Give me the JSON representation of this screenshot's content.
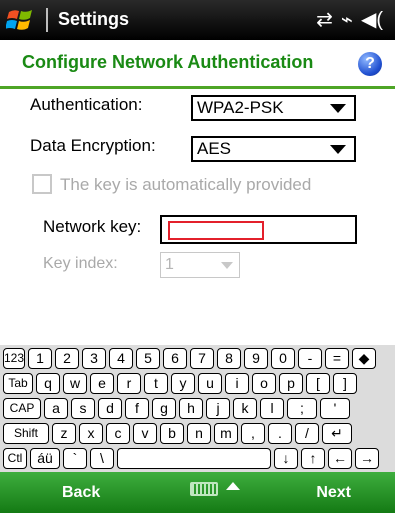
{
  "titlebar": {
    "title": "Settings",
    "icons": [
      "connectivity-icon",
      "battery-charging-icon",
      "volume-icon"
    ]
  },
  "header": {
    "title": "Configure Network Authentication",
    "help_icon": "help-icon",
    "help_glyph": "?"
  },
  "form": {
    "authentication_label": "Authentication:",
    "authentication_value": "WPA2-PSK",
    "encryption_label": "Data Encryption:",
    "encryption_value": "AES",
    "auto_key_label": "The key is automatically provided",
    "auto_key_checked": false,
    "network_key_label": "Network key:",
    "network_key_value": "",
    "key_index_label": "Key index:",
    "key_index_value": "1"
  },
  "keyboard": {
    "rows": [
      [
        "123",
        "1",
        "2",
        "3",
        "4",
        "5",
        "6",
        "7",
        "8",
        "9",
        "0",
        "-",
        "=",
        "◆"
      ],
      [
        "Tab",
        "q",
        "w",
        "e",
        "r",
        "t",
        "y",
        "u",
        "i",
        "o",
        "p",
        "[",
        "]"
      ],
      [
        "CAP",
        "a",
        "s",
        "d",
        "f",
        "g",
        "h",
        "j",
        "k",
        "l",
        ";",
        "'"
      ],
      [
        "Shift",
        "z",
        "x",
        "c",
        "v",
        "b",
        "n",
        "m",
        ",",
        ".",
        "/",
        "↵"
      ],
      [
        "Ctl",
        "áü",
        "`",
        "\\",
        "",
        "↓",
        "↑",
        "←",
        "→"
      ]
    ]
  },
  "bottombar": {
    "left": "Back",
    "right": "Next",
    "center_icon": "keyboard-icon"
  },
  "colors": {
    "header_green": "#1a8a14",
    "accent_green": "#4ea526",
    "bar_green": "#2a9a2a",
    "focus_red": "#e3202b"
  }
}
